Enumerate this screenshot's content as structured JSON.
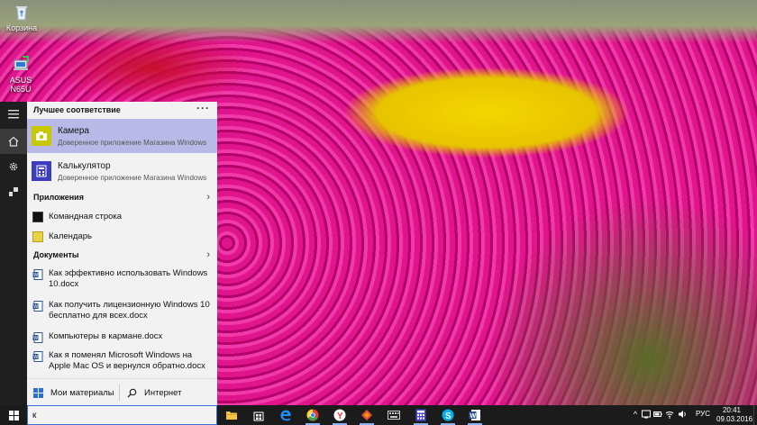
{
  "desktop": {
    "icons": [
      {
        "label": "Корзина",
        "icon": "recycle-bin-icon"
      },
      {
        "label": "ASUS N65U",
        "icon": "computer-icon"
      }
    ]
  },
  "start_menu": {
    "rail": {
      "menu_icon": "hamburger-icon",
      "home_icon": "home-icon",
      "settings_icon": "gear-icon",
      "feedback_icon": "feedback-icon"
    },
    "best_match": {
      "heading": "Лучшее соответствие",
      "more": "···",
      "items": [
        {
          "title": "Камера",
          "subtitle": "Доверенное приложение Магазина Windows",
          "icon": "camera-icon",
          "color": "#c8c800",
          "selected": true
        },
        {
          "title": "Калькулятор",
          "subtitle": "Доверенное приложение Магазина Windows",
          "icon": "calculator-icon",
          "color": "#3d3dbf",
          "selected": false
        }
      ]
    },
    "apps": {
      "heading": "Приложения",
      "items": [
        {
          "label": "Командная строка",
          "icon": "cmd-icon"
        },
        {
          "label": "Календарь",
          "icon": "calendar-icon"
        }
      ]
    },
    "documents": {
      "heading": "Документы",
      "items": [
        {
          "label": "Как эффективно использовать Windows 10.docx"
        },
        {
          "label": "Как получить лицензионную Windows 10 бесплатно для всех.docx"
        },
        {
          "label": "Компьютеры в кармане.docx"
        },
        {
          "label": "Как я поменял Microsoft Windows на Apple Mac OS и вернулся обратно.docx"
        }
      ]
    },
    "tabs": {
      "my_stuff": "Мои материалы",
      "web": "Интернет"
    }
  },
  "taskbar": {
    "search_value": "к",
    "apps": [
      {
        "name": "file-explorer-icon",
        "color": "#f5c242"
      },
      {
        "name": "store-icon",
        "color": "#ffffff"
      },
      {
        "name": "edge-icon",
        "color": "#1e90ff"
      },
      {
        "name": "chrome-icon",
        "color": "#4caf50"
      },
      {
        "name": "yandex-browser-icon",
        "color": "#ff3333"
      },
      {
        "name": "app-icon",
        "color": "#e74c3c"
      },
      {
        "name": "keyboard-icon",
        "color": "#cccccc"
      },
      {
        "name": "calculator-taskbar-icon",
        "color": "#4a4acc"
      },
      {
        "name": "skype-icon",
        "color": "#00aff0"
      },
      {
        "name": "word-icon",
        "color": "#2b5797"
      }
    ],
    "tray": {
      "language": "РУС",
      "time": "20:41",
      "date": "09.03.2016"
    }
  }
}
